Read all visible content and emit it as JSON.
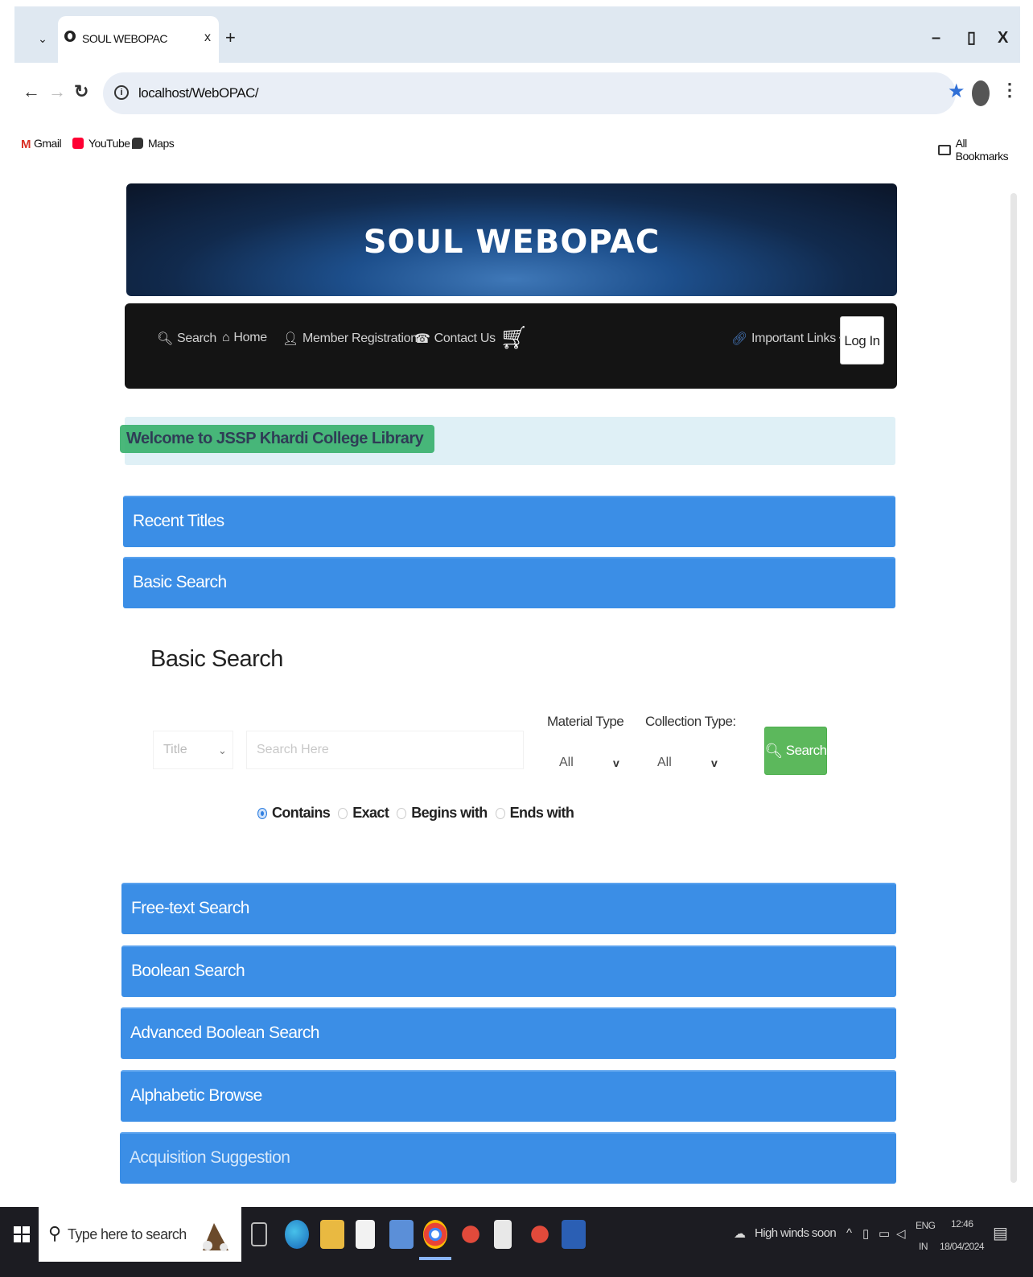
{
  "browser": {
    "tab_title": "SOUL WEBOPAC",
    "url": "localhost/WebOPAC/",
    "bookmarks": [
      {
        "label": "Gmail",
        "icon": "gmail-icon"
      },
      {
        "label": "YouTube",
        "icon": "youtube-icon"
      },
      {
        "label": "Maps",
        "icon": "maps-icon"
      }
    ],
    "all_bookmarks": "All Bookmarks",
    "window_controls": {
      "minimize": "–",
      "restore": "▯",
      "close": "X"
    },
    "new_tab": "+",
    "tab_close": "x"
  },
  "header": {
    "title": "SOUL WEBOPAC"
  },
  "navbar": {
    "items": [
      {
        "label": "Search",
        "icon": "search-icon"
      },
      {
        "label": "Home",
        "icon": "home-icon"
      },
      {
        "label": "Member Registration",
        "icon": "user-icon"
      },
      {
        "label": "Contact Us",
        "icon": "phone-icon"
      }
    ],
    "important_links": "Important Links",
    "login": "Log In"
  },
  "welcome": "Welcome to JSSP Khardi College Library",
  "panels": {
    "recent_titles": "Recent Titles",
    "basic_search": "Basic Search",
    "free_text": "Free-text Search",
    "boolean": "Boolean Search",
    "advanced_boolean": "Advanced Boolean Search",
    "alphabetic": "Alphabetic Browse",
    "acquisition": "Acquisition Suggestion"
  },
  "basic_search": {
    "heading": "Basic Search",
    "field_value": "Title",
    "search_placeholder": "Search Here",
    "material_type_label": "Material Type",
    "material_type_value": "All",
    "collection_type_label": "Collection Type:",
    "collection_type_value": "All",
    "search_button": "Search",
    "match_options": [
      "Contains",
      "Exact",
      "Begins with",
      "Ends with"
    ],
    "selected_match": "Contains"
  },
  "taskbar": {
    "search_placeholder": "Type here to search",
    "weather": "High winds soon",
    "language": "ENG",
    "region": "IN",
    "time": "12:46",
    "date": "18/04/2024"
  },
  "colors": {
    "panel_blue": "#3b8ee6",
    "navbar_dark": "#141414",
    "search_green": "#5cb85c",
    "welcome_bg": "#dff0f6",
    "welcome_highlight": "#37b06c"
  }
}
